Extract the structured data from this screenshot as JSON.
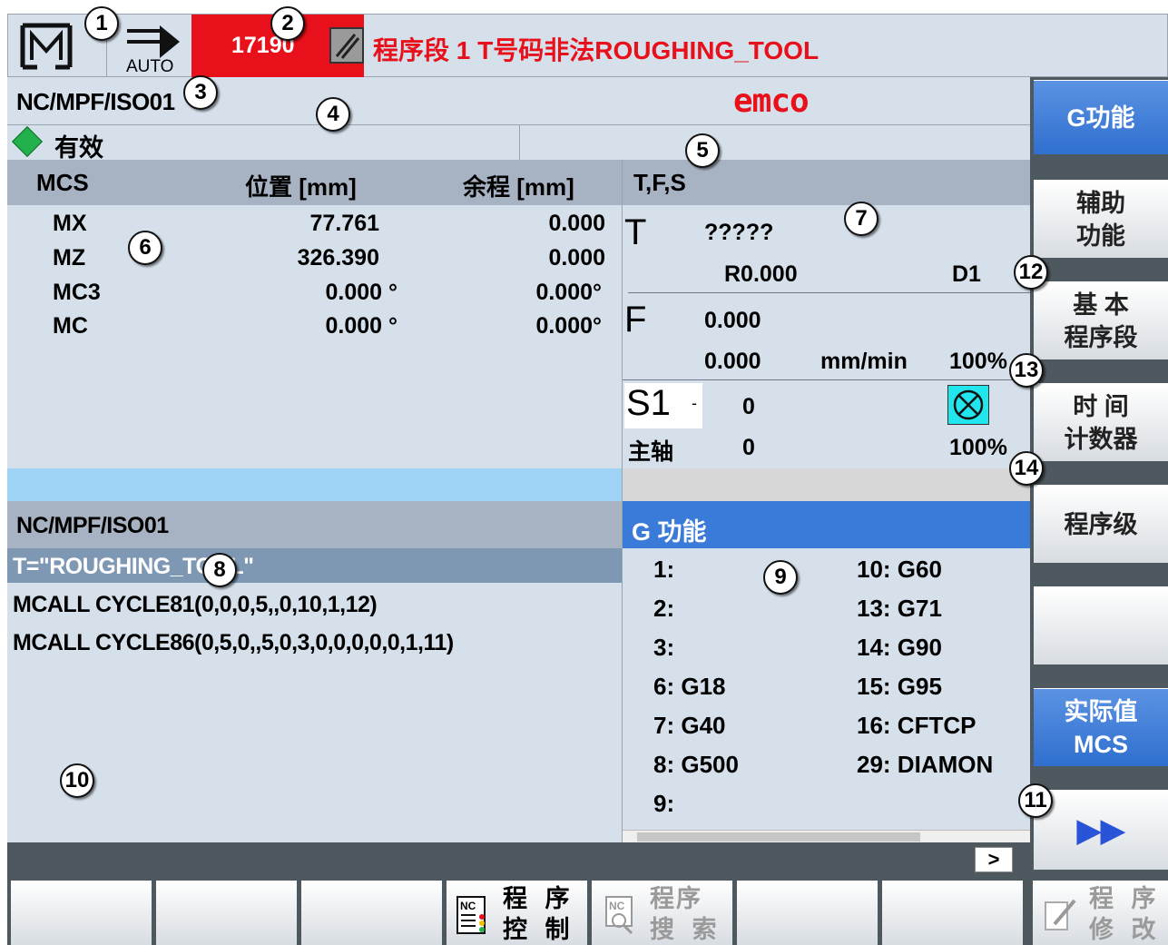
{
  "header": {
    "mode_label": "AUTO",
    "alarm_number": "17190",
    "alarm_text": "程序段 1 T号码非法ROUGHING_TOOL"
  },
  "path_row": {
    "program_path": "NC/MPF/ISO01",
    "logo": "emco"
  },
  "status": {
    "text": "有效"
  },
  "position": {
    "headers": [
      "MCS",
      "位置 [mm]",
      "余程 [mm]"
    ],
    "rows": [
      {
        "axis": "MX",
        "pos": "77.761",
        "dist": "0.000"
      },
      {
        "axis": "MZ",
        "pos": "326.390",
        "dist": "0.000"
      },
      {
        "axis": "MC3",
        "pos": "0.000 °",
        "dist": "0.000°"
      },
      {
        "axis": "MC",
        "pos": "0.000 °",
        "dist": "0.000°"
      }
    ]
  },
  "tfs": {
    "title": "T,F,S",
    "t_label": "T",
    "tool_name": "?????",
    "radius": "R0.000",
    "d_number": "D1",
    "f_label": "F",
    "feed_actual": "0.000",
    "feed_set": "0.000",
    "feed_unit": "mm/min",
    "feed_override": "100%",
    "spindle_label": "S1",
    "spindle_dropdown": "-",
    "spindle_speed": "0",
    "spindle_name": "主轴",
    "spindle_value": "0",
    "spindle_override": "100%"
  },
  "program": {
    "path": "NC/MPF/ISO01",
    "lines": [
      "T=\"ROUGHING_TOOL\"",
      "MCALL CYCLE81(0,0,0,5,,0,10,1,12)",
      "MCALL CYCLE86(0,5,0,,5,0,3,0,0,0,0,0,1,11)"
    ]
  },
  "gfunc": {
    "title": "G 功能",
    "left": [
      "1:",
      "2:",
      "3:",
      "6: G18",
      "7: G40",
      "8: G500",
      "9:"
    ],
    "right": [
      "10: G60",
      "13: G71",
      "14: G90",
      "15: G95",
      "16: CFTCP",
      "29: DIAMON"
    ]
  },
  "msg_bar": {
    "more": ">"
  },
  "softkeys_v": [
    {
      "l1": "G功能",
      "l2": ""
    },
    {
      "l1": "辅助",
      "l2": "功能"
    },
    {
      "l1": "基 本",
      "l2": "程序段"
    },
    {
      "l1": "时 间",
      "l2": "计数器"
    },
    {
      "l1": "程序级",
      "l2": ""
    },
    {
      "l1": "",
      "l2": ""
    },
    {
      "l1": "实际值",
      "l2": "MCS"
    },
    {
      "l1": "▶▶",
      "l2": ""
    }
  ],
  "softkeys_h": [
    {
      "l1": "",
      "l2": ""
    },
    {
      "l1": "",
      "l2": ""
    },
    {
      "l1": "",
      "l2": ""
    },
    {
      "l1": "程 序",
      "l2": "控 制"
    },
    {
      "l1": "程序",
      "l2": "搜 索"
    },
    {
      "l1": "",
      "l2": ""
    },
    {
      "l1": "",
      "l2": ""
    },
    {
      "l1": "程 序",
      "l2": "修 改"
    }
  ],
  "markers": [
    "1",
    "2",
    "3",
    "4",
    "5",
    "6",
    "7",
    "8",
    "9",
    "10",
    "11",
    "12",
    "13",
    "14"
  ],
  "colors": {
    "panel_bg": "#d5e0eb",
    "header_grey": "#a7b3c2",
    "alarm_red": "#e8101a",
    "active_blue": "#3a7ad8",
    "status_green": "#22b14c",
    "spindle_cyan": "#22e6ee"
  }
}
